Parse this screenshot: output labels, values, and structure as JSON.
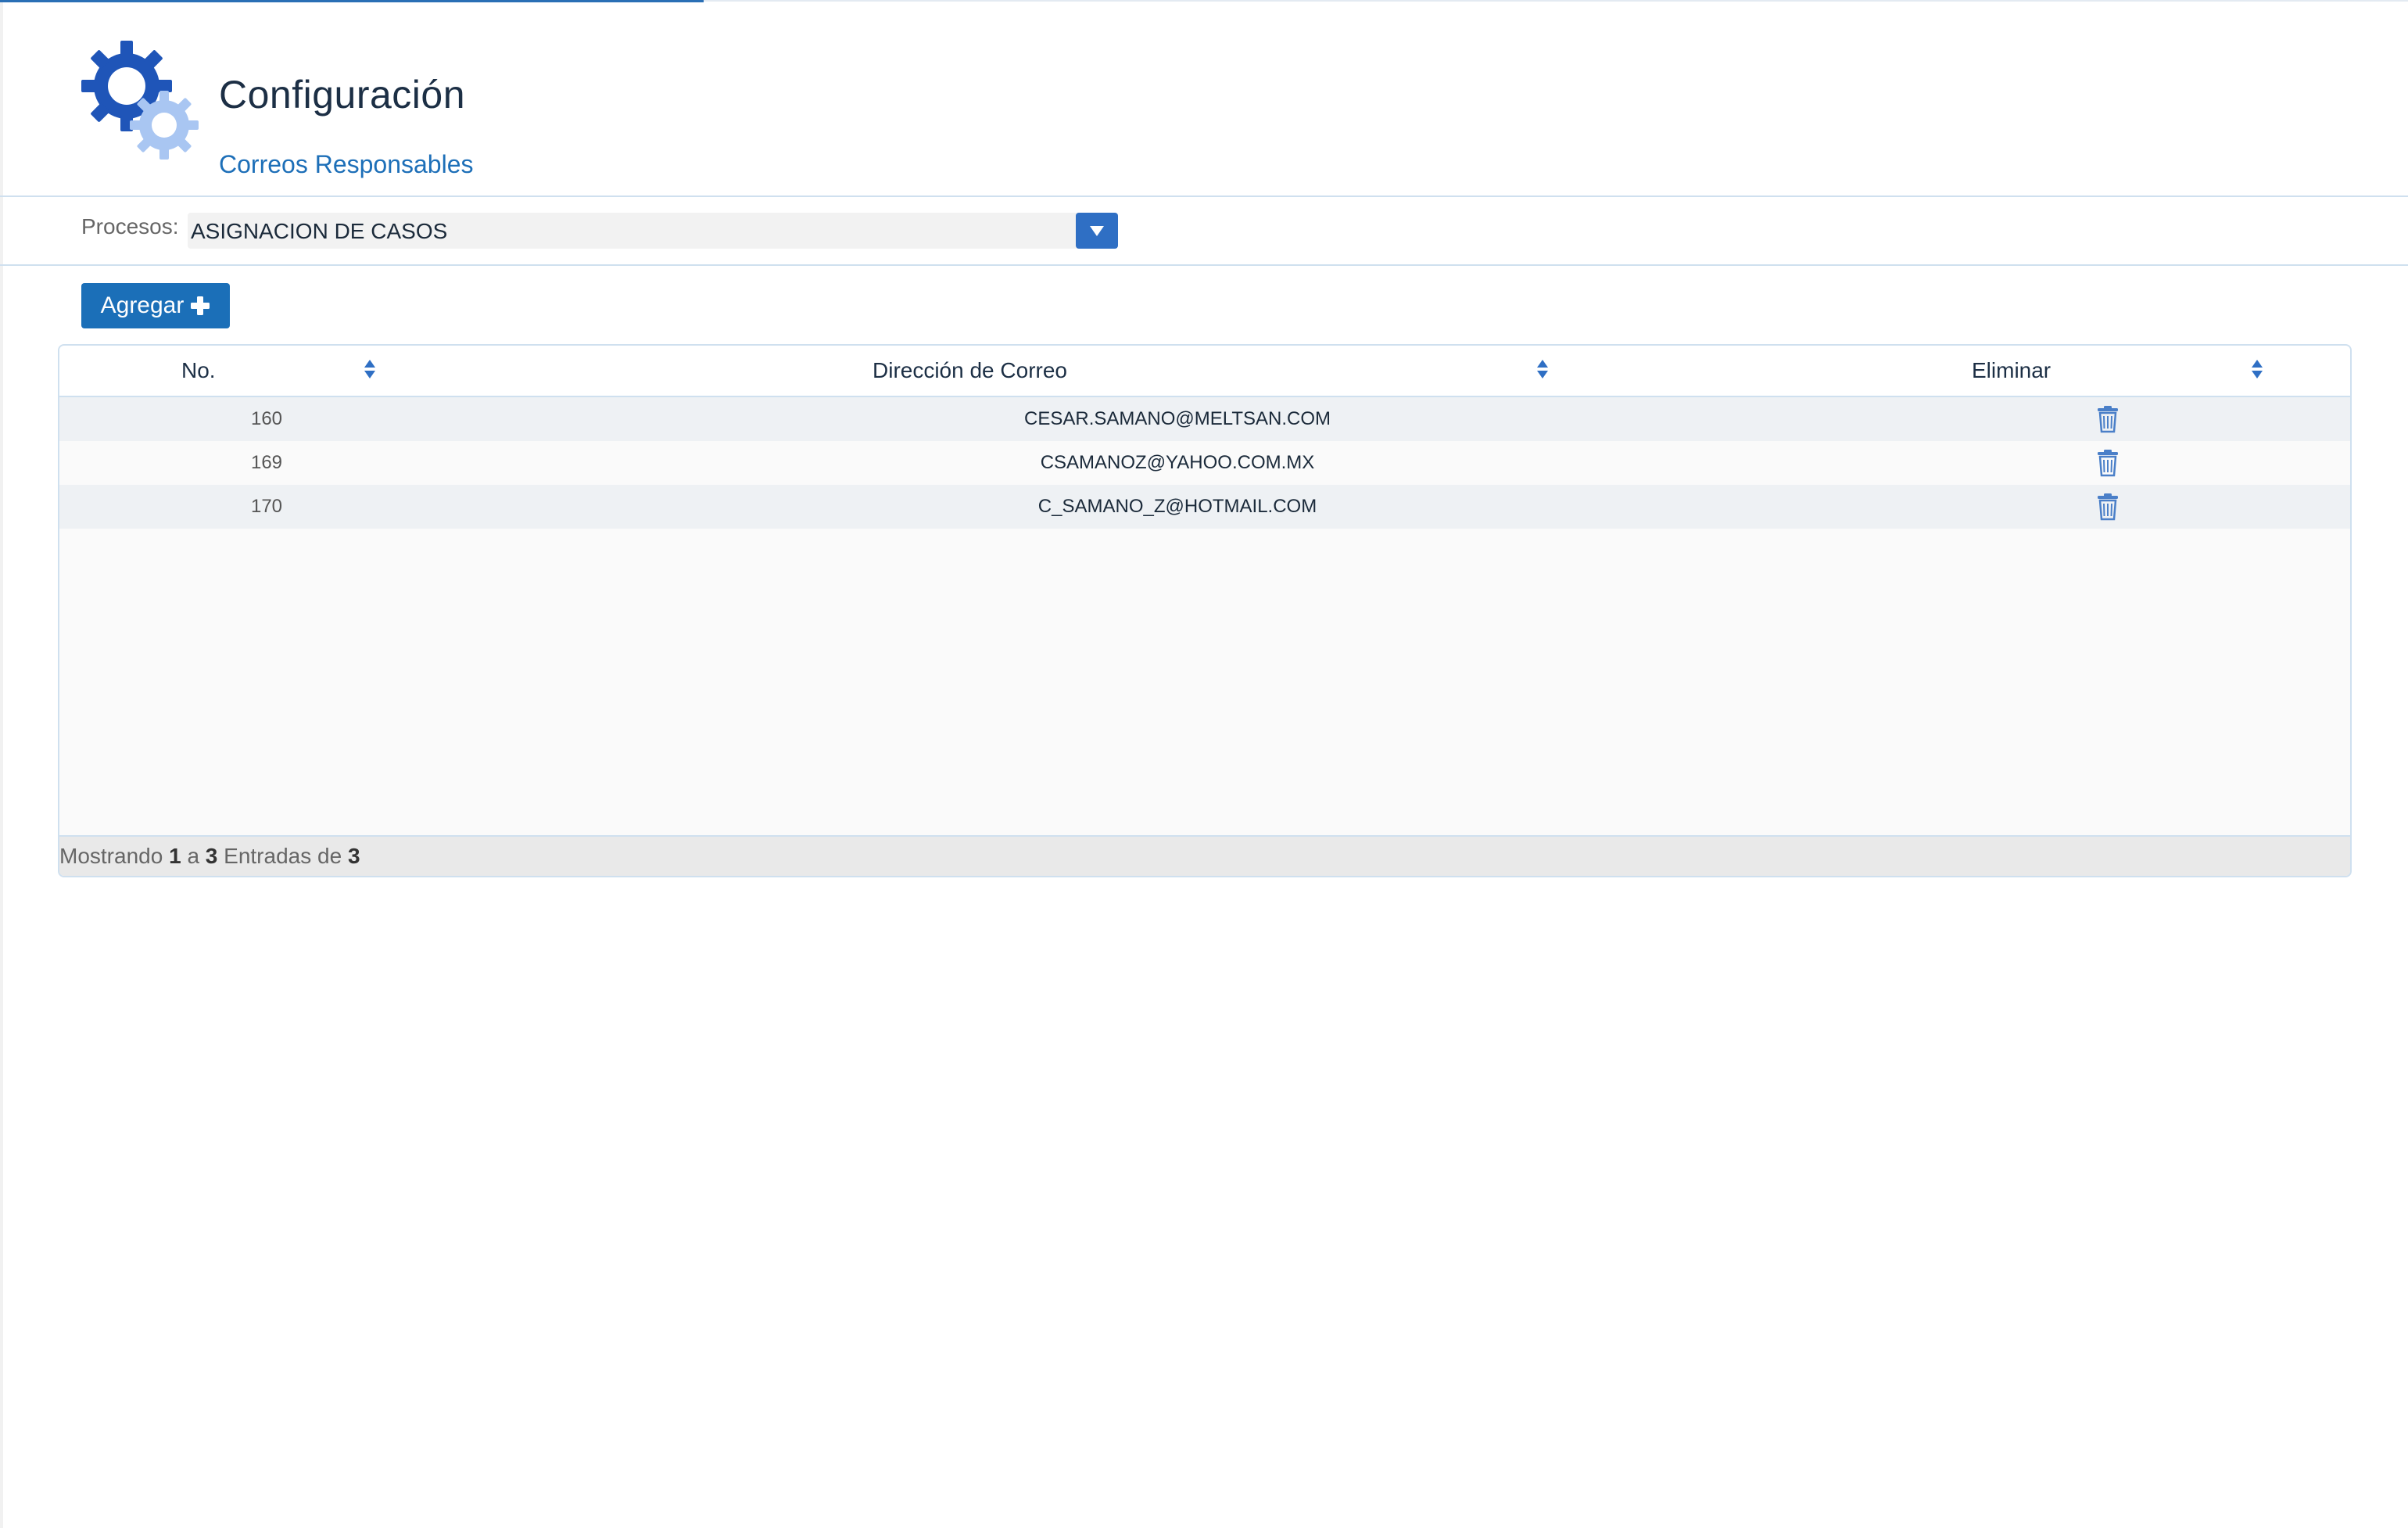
{
  "header": {
    "title": "Configuración",
    "subtitle": "Correos Responsables"
  },
  "filter": {
    "label": "Procesos:",
    "selected": "ASIGNACION DE CASOS"
  },
  "toolbar": {
    "add_label": "Agregar"
  },
  "table": {
    "columns": [
      {
        "label": "No."
      },
      {
        "label": "Dirección de Correo"
      },
      {
        "label": "Eliminar"
      }
    ],
    "rows": [
      {
        "no": "160",
        "email": "CESAR.SAMANO@MELTSAN.COM"
      },
      {
        "no": "169",
        "email": "CSAMANOZ@YAHOO.COM.MX"
      },
      {
        "no": "170",
        "email": "C_SAMANO_Z@HOTMAIL.COM"
      }
    ],
    "footer": {
      "prefix": "Mostrando",
      "from": "1",
      "sep": "a",
      "to": "3",
      "mid": "Entradas de",
      "total": "3"
    }
  },
  "colors": {
    "accent": "#1b6fb8",
    "border": "#cfe0ef",
    "gear_dark": "#1f55b8",
    "gear_light": "#a9c6f2",
    "trash": "#4a7fc8"
  },
  "icons": {
    "logo": "gears-icon",
    "sort": "sort-icon",
    "delete": "trash-icon",
    "dropdown": "chevron-down-icon",
    "add": "plus-icon"
  }
}
